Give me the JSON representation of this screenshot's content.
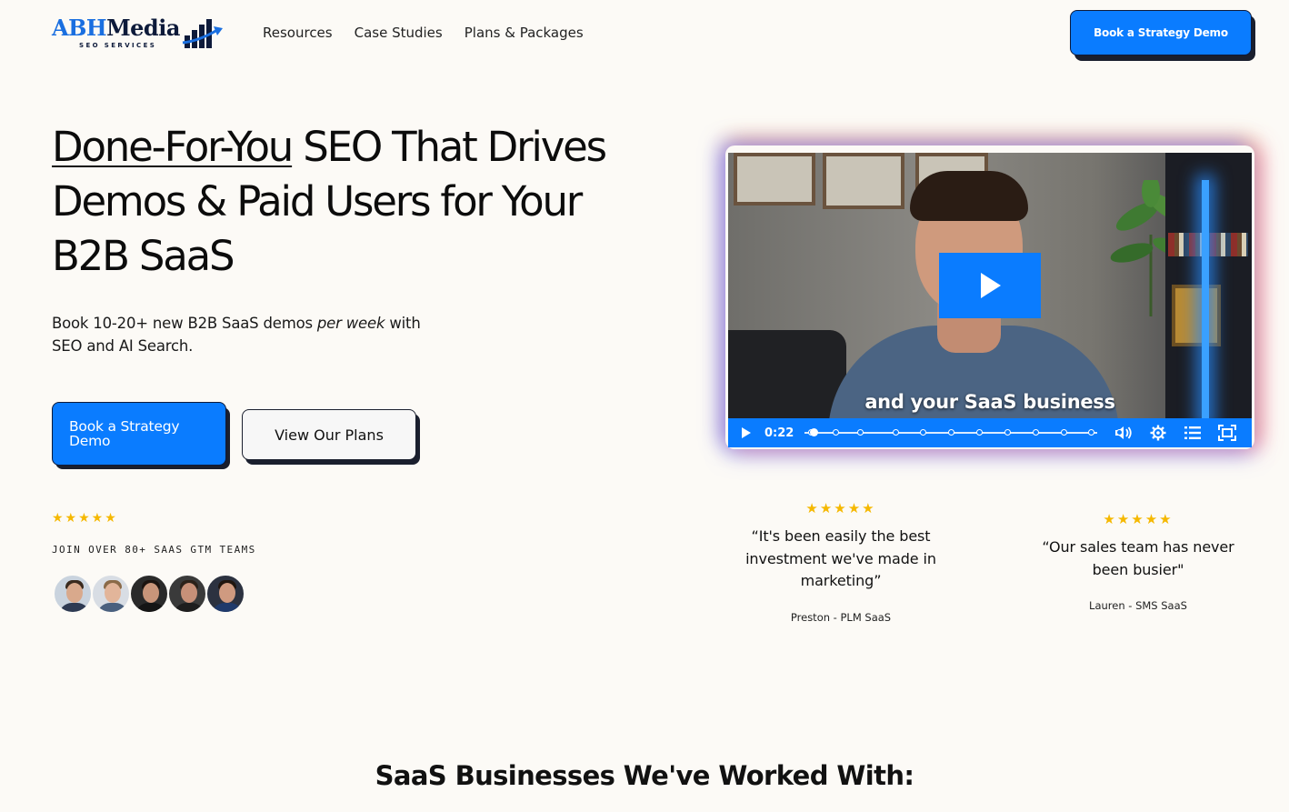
{
  "header": {
    "logo": {
      "brand_primary": "ABH",
      "brand_secondary": "Media",
      "tagline": "SEO SERVICES"
    },
    "nav": [
      {
        "label": "Resources"
      },
      {
        "label": "Case Studies"
      },
      {
        "label": "Plans & Packages"
      }
    ],
    "cta_label": "Book a Strategy Demo"
  },
  "hero": {
    "title_underlined": "Done-For-You",
    "title_rest": " SEO That Drives Demos & Paid Users for Your B2B SaaS",
    "subtitle_before": "Book 10-20+ new B2B SaaS demos ",
    "subtitle_emphasis": "per week",
    "subtitle_after": " with SEO and AI Search.",
    "primary_cta": "Book a Strategy Demo",
    "secondary_cta": "View Our Plans",
    "rating_stars": "★★★★★",
    "join_text": "JOIN OVER 80+ SAAS GTM TEAMS",
    "avatars": [
      {
        "alt": "Client 1"
      },
      {
        "alt": "Client 2"
      },
      {
        "alt": "Client 3"
      },
      {
        "alt": "Client 4"
      },
      {
        "alt": "Client 5"
      }
    ]
  },
  "video": {
    "caption": "and your SaaS business",
    "current_time": "0:22",
    "progress": 0.02,
    "chapter_markers": 12
  },
  "testimonials": [
    {
      "stars": "★★★★★",
      "quote": "“It's been easily the best investment we've made in marketing”",
      "author": "Preston - PLM SaaS"
    },
    {
      "stars": "★★★★★",
      "quote": "“Our sales team has never been busier\"",
      "author": "Lauren - SMS SaaS"
    }
  ],
  "section": {
    "title": "SaaS Businesses We've Worked With:"
  },
  "colors": {
    "accent": "#0a7cff",
    "background": "#fcfaf6",
    "dark": "#1a1f2e",
    "star": "#f5b800",
    "logo_blue": "#1a6fe0",
    "logo_navy": "#0d1a3a"
  }
}
